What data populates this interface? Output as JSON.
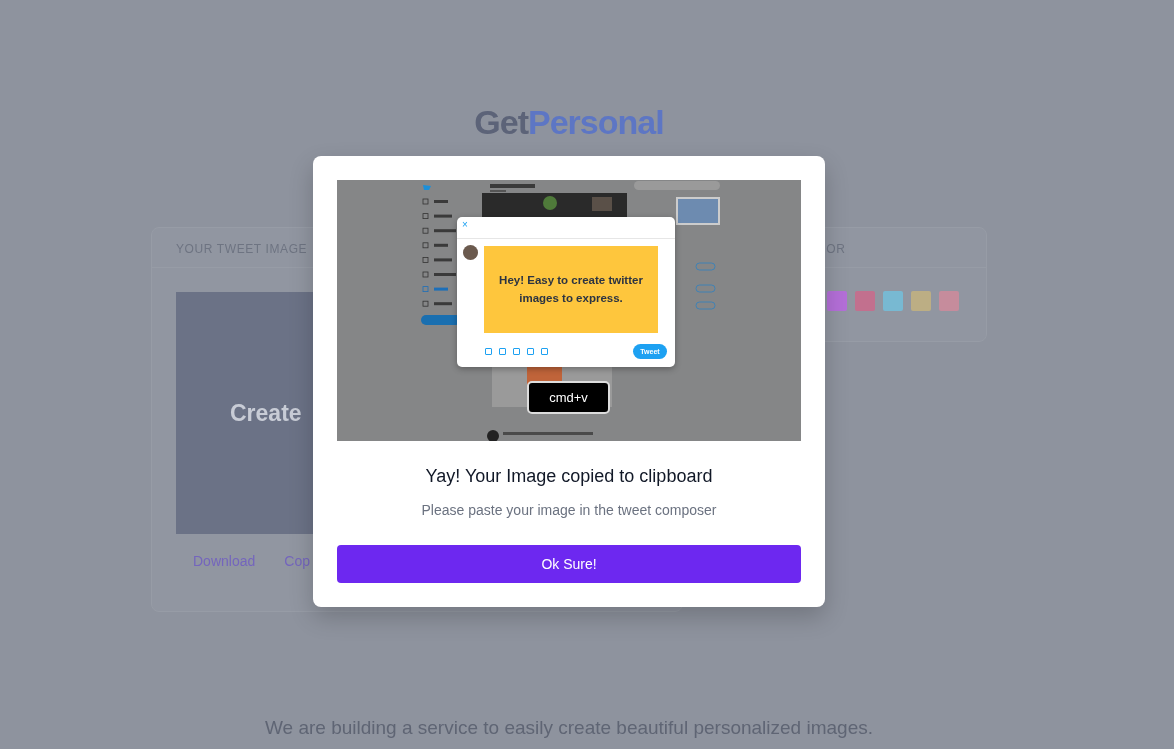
{
  "logo": {
    "first": "Get",
    "second": "Personal"
  },
  "image_card": {
    "header": "YOUR TWEET IMAGE",
    "preview_text": "Create",
    "actions": [
      "Download",
      "Cop"
    ]
  },
  "color_card": {
    "header": "OR",
    "swatches": [
      {
        "color": "#b46fd8"
      },
      {
        "color": "#c2708e"
      },
      {
        "color": "#78b9d2"
      },
      {
        "color": "#bcae84"
      },
      {
        "color": "#c68c9c"
      }
    ]
  },
  "footer": "We are building a service to easily create beautiful personalized images.",
  "modal": {
    "demo": {
      "composer": {
        "close": "×",
        "card_text": "Hey! Easy to create twitter images to express.",
        "button": "Tweet"
      },
      "shortcut": "cmd+v"
    },
    "title": "Yay! Your Image copied to clipboard",
    "subtitle": "Please paste your image in the tweet composer",
    "button": "Ok Sure!"
  }
}
